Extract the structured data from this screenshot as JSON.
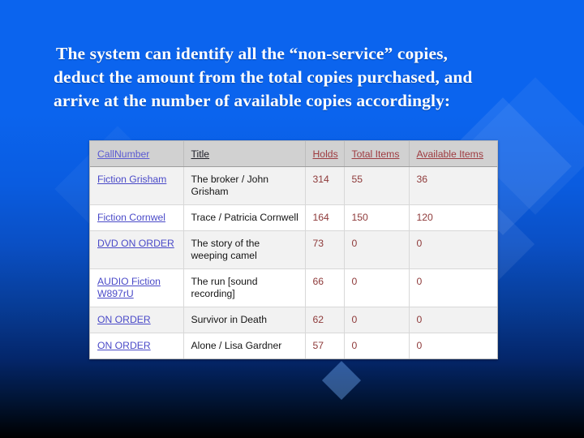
{
  "slide": {
    "heading_lines": [
      "The system can identify all the “non-service” copies,",
      "deduct the amount from the total copies purchased, and",
      "arrive at the number of available copies accordingly:"
    ]
  },
  "table": {
    "headers": [
      {
        "label": "CallNumber",
        "style": "blue"
      },
      {
        "label": "Title ",
        "style": "dark"
      },
      {
        "label": "Holds",
        "style": "red"
      },
      {
        "label": "Total  Items",
        "style": "red"
      },
      {
        "label": "Available  Items",
        "style": "red"
      }
    ],
    "rows": [
      {
        "call_number": "Fiction Grisham",
        "title": "The broker / John Grisham",
        "holds": "314",
        "total_items": "55",
        "available_items": "36"
      },
      {
        "call_number": "Fiction Cornwel",
        "title": "Trace / Patricia Cornwell",
        "holds": "164",
        "total_items": "150",
        "available_items": "120"
      },
      {
        "call_number": "DVD ON ORDER",
        "title": "The story of the weeping camel",
        "holds": "73",
        "total_items": "0",
        "available_items": "0"
      },
      {
        "call_number": "AUDIO Fiction W897rU",
        "title": "The run [sound recording]",
        "holds": "66",
        "total_items": "0",
        "available_items": "0"
      },
      {
        "call_number": "ON ORDER",
        "title": "Survivor in Death",
        "holds": "62",
        "total_items": "0",
        "available_items": "0"
      },
      {
        "call_number": "ON ORDER",
        "title": "Alone / Lisa Gardner",
        "holds": "57",
        "total_items": "0",
        "available_items": "0"
      }
    ]
  },
  "colors": {
    "background_top": "#0b64ee",
    "background_bottom": "#000000",
    "header_fill": "#d1d1d1",
    "link_blue": "#4a4ac8",
    "header_red": "#9e3b40",
    "number_red": "#8e3a3a",
    "row_alt": "#f2f2f2"
  }
}
